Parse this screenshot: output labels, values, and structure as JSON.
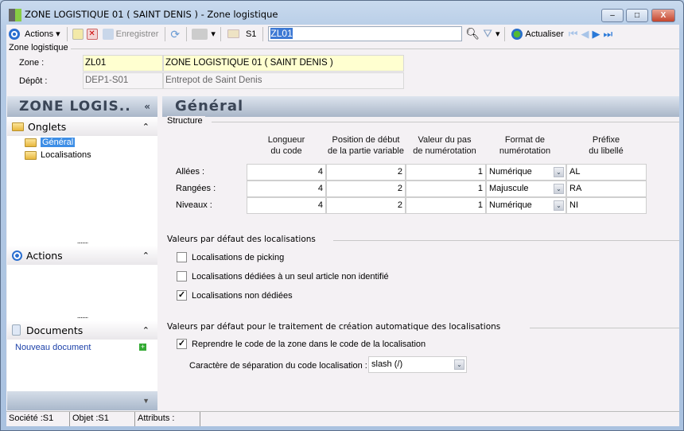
{
  "window": {
    "title": "ZONE  LOGISTIQUE  01  ( SAINT DENIS ) -  Zone logistique",
    "minimize": "–",
    "maximize": "□",
    "close": "X"
  },
  "toolbar": {
    "actions": "Actions",
    "save": "Enregistrer",
    "site": "S1",
    "search_value": "ZL01",
    "refresh": "Actualiser"
  },
  "header": {
    "group": "Zone logistique",
    "zone_label": "Zone :",
    "zone_code": "ZL01",
    "zone_name": "ZONE  LOGISTIQUE  01  ( SAINT DENIS )",
    "depot_label": "Dépôt :",
    "depot_code": "DEP1-S01",
    "depot_name": "Entrepot de  Saint  Denis"
  },
  "left": {
    "title": "ZONE  LOGIS..",
    "collapse": "«",
    "onglets": "Onglets",
    "tabs": [
      "Général",
      "Localisations"
    ],
    "actions": "Actions",
    "documents": "Documents",
    "new_doc": "Nouveau document",
    "chev": "⌃",
    "dots": "........."
  },
  "main": {
    "title": "Général",
    "structure": "Structure",
    "columns": [
      "Longueur\ndu code",
      "Position de début\nde la partie variable",
      "Valeur du pas\nde numérotation",
      "Format de\nnumérotation",
      "Préfixe\ndu libellé"
    ],
    "rows": [
      {
        "label": "Allées :",
        "len": "4",
        "pos": "2",
        "step": "1",
        "format": "Numérique",
        "prefix": "AL"
      },
      {
        "label": "Rangées :",
        "len": "4",
        "pos": "2",
        "step": "1",
        "format": "Majuscule",
        "prefix": "RA"
      },
      {
        "label": "Niveaux :",
        "len": "4",
        "pos": "2",
        "step": "1",
        "format": "Numérique",
        "prefix": "NI"
      }
    ],
    "defaults_title": "Valeurs par défaut des localisations",
    "options": [
      {
        "label": "Localisations de picking",
        "checked": false
      },
      {
        "label": "Localisations dédiées à un seul article non identifié",
        "checked": false
      },
      {
        "label": "Localisations non dédiées",
        "checked": true
      }
    ],
    "auto_title": "Valeurs par défaut pour le traitement de création automatique des localisations",
    "auto_option": "Reprendre le code de la zone dans le code de la localisation",
    "separator_label": "Caractère de séparation du code localisation :",
    "separator_value": "slash (/)"
  },
  "status": {
    "societe": "Société :S1",
    "objet": "Objet :S1",
    "attributs": "Attributs :"
  }
}
